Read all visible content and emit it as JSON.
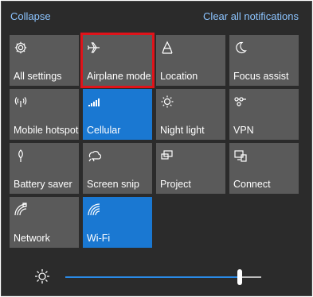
{
  "header": {
    "collapse_label": "Collapse",
    "clear_label": "Clear all notifications"
  },
  "colors": {
    "panel_bg": "#2b2b2b",
    "tile_bg": "#5a5a5a",
    "tile_active_bg": "#1a78d2",
    "link": "#8cc4ff",
    "highlight_border": "#e0131a"
  },
  "tiles": [
    {
      "label": "All settings",
      "icon": "gear-icon",
      "active": false
    },
    {
      "label": "Airplane mode",
      "icon": "airplane-icon",
      "active": false,
      "highlighted": true
    },
    {
      "label": "Location",
      "icon": "location-icon",
      "active": false
    },
    {
      "label": "Focus assist",
      "icon": "moon-icon",
      "active": false
    },
    {
      "label": "Mobile hotspot",
      "icon": "hotspot-icon",
      "active": false
    },
    {
      "label": "Cellular",
      "icon": "cellular-icon",
      "active": true
    },
    {
      "label": "Night light",
      "icon": "night-light-icon",
      "active": false
    },
    {
      "label": "VPN",
      "icon": "vpn-icon",
      "active": false
    },
    {
      "label": "Battery saver",
      "icon": "battery-saver-icon",
      "active": false
    },
    {
      "label": "Screen snip",
      "icon": "screen-snip-icon",
      "active": false
    },
    {
      "label": "Project",
      "icon": "project-icon",
      "active": false
    },
    {
      "label": "Connect",
      "icon": "connect-icon",
      "active": false
    },
    {
      "label": "Network",
      "icon": "network-icon",
      "active": false
    },
    {
      "label": "Wi-Fi",
      "icon": "wifi-icon",
      "active": true
    }
  ],
  "brightness": {
    "icon": "brightness-icon",
    "level": 0.89
  }
}
